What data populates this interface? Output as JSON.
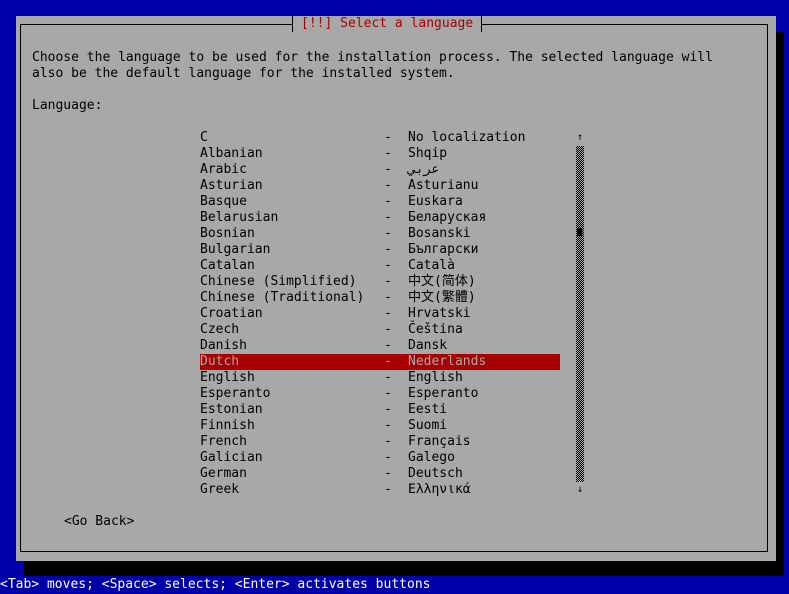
{
  "dialog": {
    "title": "[!!] Select a language",
    "description": "Choose the language to be used for the installation process. The selected language will\nalso be the default language for the installed system.",
    "list_label": "Language:",
    "selected_index": 14,
    "languages": [
      {
        "name": "C",
        "native": "No localization"
      },
      {
        "name": "Albanian",
        "native": "Shqip"
      },
      {
        "name": "Arabic",
        "native": "عربي"
      },
      {
        "name": "Asturian",
        "native": "Asturianu"
      },
      {
        "name": "Basque",
        "native": "Euskara"
      },
      {
        "name": "Belarusian",
        "native": "Беларуская"
      },
      {
        "name": "Bosnian",
        "native": "Bosanski"
      },
      {
        "name": "Bulgarian",
        "native": "Български"
      },
      {
        "name": "Catalan",
        "native": "Català"
      },
      {
        "name": "Chinese (Simplified)",
        "native": "中文(简体)"
      },
      {
        "name": "Chinese (Traditional)",
        "native": "中文(繁體)"
      },
      {
        "name": "Croatian",
        "native": "Hrvatski"
      },
      {
        "name": "Czech",
        "native": "Čeština"
      },
      {
        "name": "Danish",
        "native": "Dansk"
      },
      {
        "name": "Dutch",
        "native": "Nederlands"
      },
      {
        "name": "English",
        "native": "English"
      },
      {
        "name": "Esperanto",
        "native": "Esperanto"
      },
      {
        "name": "Estonian",
        "native": "Eesti"
      },
      {
        "name": "Finnish",
        "native": "Suomi"
      },
      {
        "name": "French",
        "native": "Français"
      },
      {
        "name": "Galician",
        "native": "Galego"
      },
      {
        "name": "German",
        "native": "Deutsch"
      },
      {
        "name": "Greek",
        "native": "Ελληνικά"
      }
    ],
    "separator": "-",
    "scroll_up": "↑",
    "scroll_down": "↓",
    "go_back_label": "<Go Back>"
  },
  "help_bar": "<Tab> moves; <Space> selects; <Enter> activates buttons",
  "colors": {
    "background": "#0000a8",
    "dialog": "#a8a8a8",
    "title": "#a80000",
    "selection": "#a80000"
  }
}
